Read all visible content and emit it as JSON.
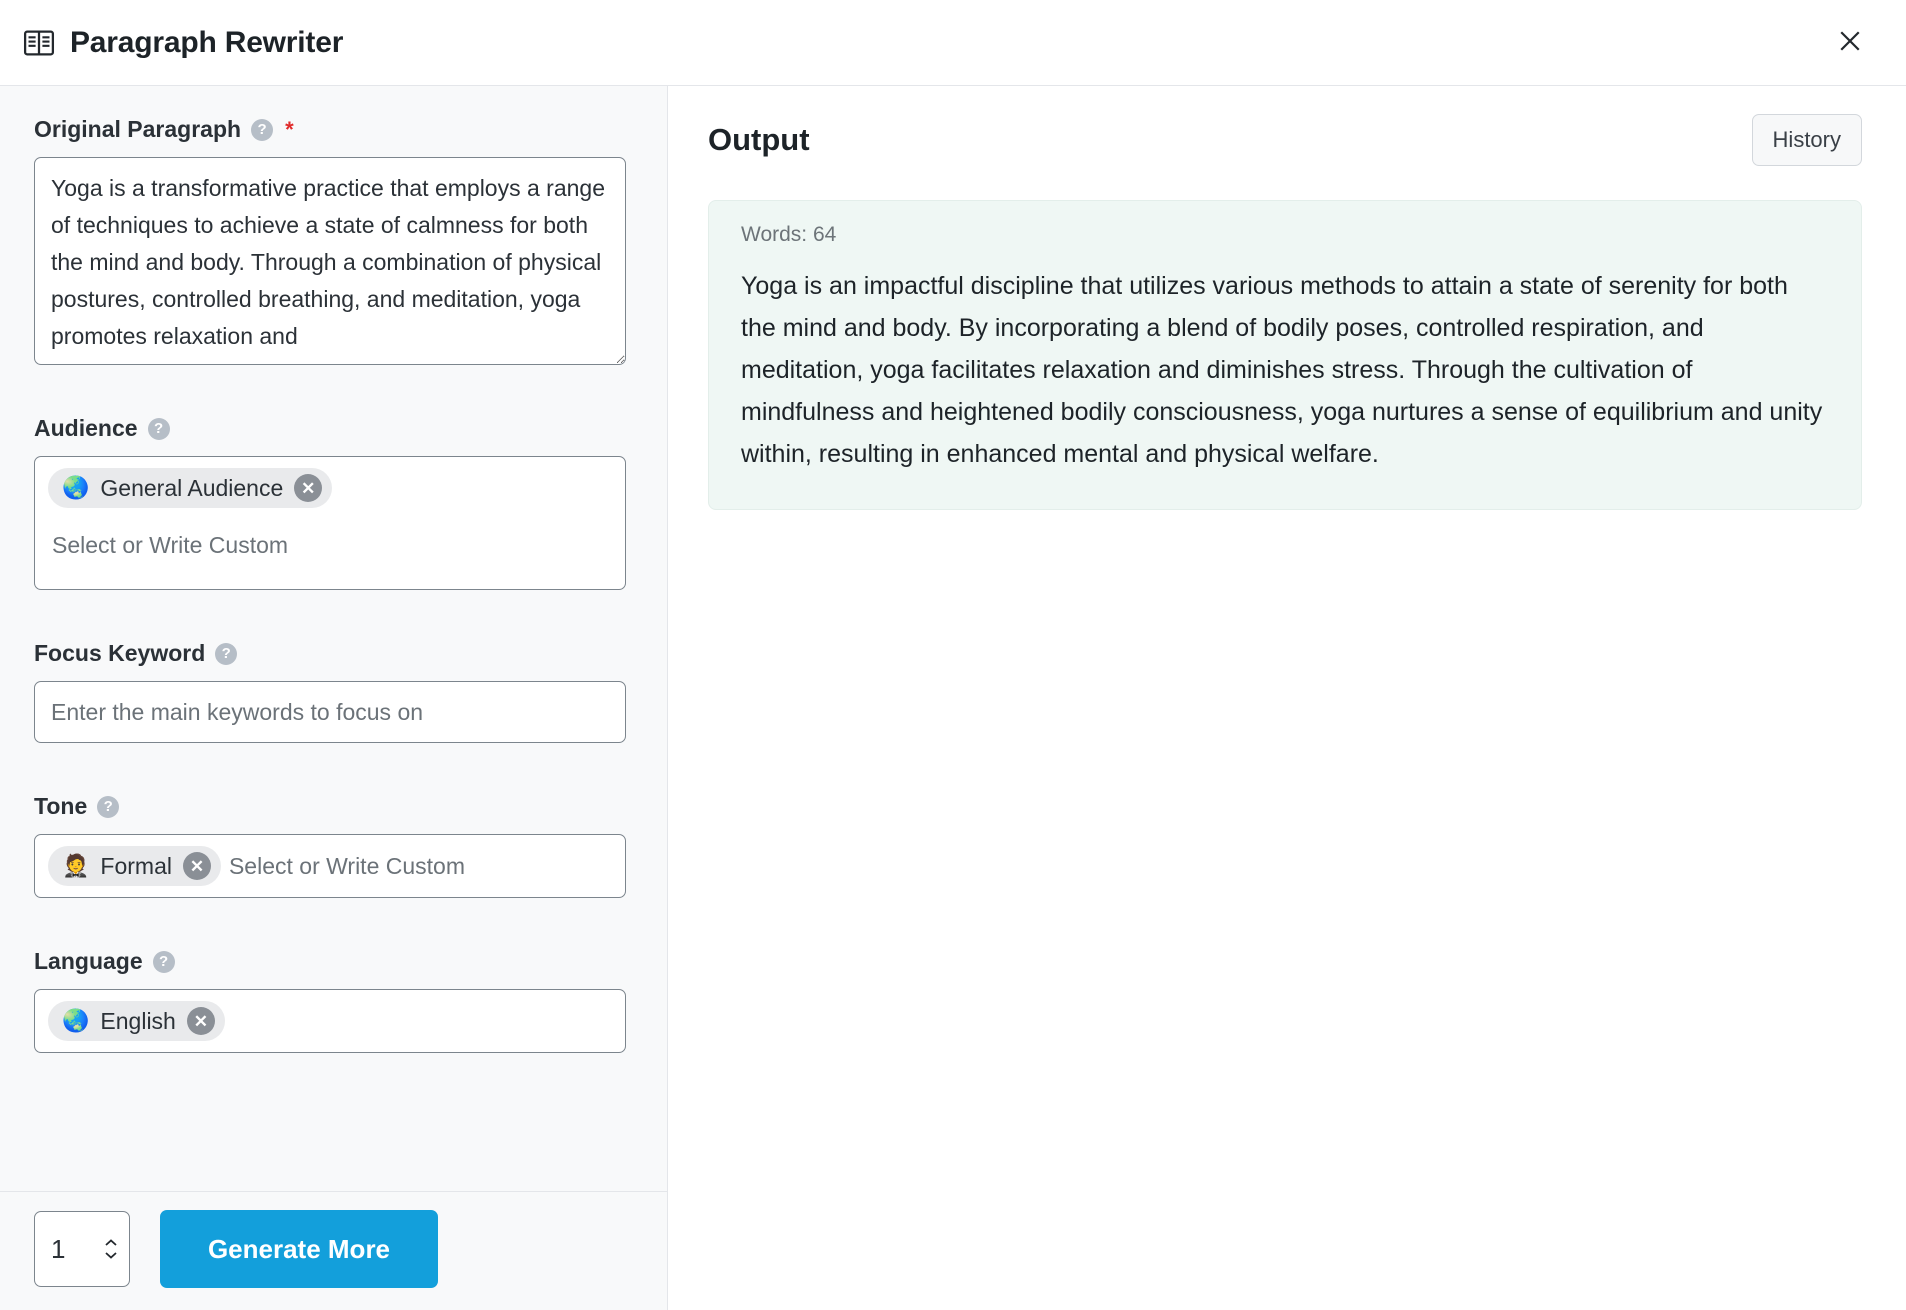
{
  "header": {
    "icon": "open-book-icon",
    "title": "Paragraph Rewriter",
    "close_label": "×"
  },
  "left_panel": {
    "original_paragraph": {
      "label": "Original Paragraph",
      "help": "?",
      "required_mark": "*",
      "value": "Yoga is a transformative practice that employs a range of techniques to achieve a state of calmness for both the mind and body. Through a combination of physical postures, controlled breathing, and meditation, yoga promotes relaxation and"
    },
    "audience": {
      "label": "Audience",
      "help": "?",
      "chip": {
        "emoji": "🌏",
        "label": "General Audience",
        "remove": "✕"
      },
      "placeholder": "Select or Write Custom"
    },
    "focus_keyword": {
      "label": "Focus Keyword",
      "help": "?",
      "value": "",
      "placeholder": "Enter the main keywords to focus on"
    },
    "tone": {
      "label": "Tone",
      "help": "?",
      "chip": {
        "emoji": "🤵",
        "label": "Formal",
        "remove": "✕"
      },
      "placeholder": "Select or Write Custom"
    },
    "language": {
      "label": "Language",
      "help": "?",
      "chip": {
        "emoji": "🌏",
        "label": "English",
        "remove": "✕"
      }
    },
    "footer": {
      "count_value": "1",
      "generate_label": "Generate More"
    }
  },
  "right_panel": {
    "title": "Output",
    "history_label": "History",
    "result": {
      "words_label": "Words: 64",
      "text": "Yoga is an impactful discipline that utilizes various methods to attain a state of serenity for both the mind and body. By incorporating a blend of bodily poses, controlled respiration, and meditation, yoga facilitates relaxation and diminishes stress. Through the cultivation of mindfulness and heightened bodily consciousness, yoga nurtures a sense of equilibrium and unity within, resulting in enhanced mental and physical welfare."
    }
  },
  "colors": {
    "accent": "#139fdb",
    "panel_bg": "#f8f9fa",
    "output_card_bg": "#eff7f4",
    "required_star": "#e02b2b",
    "chip_bg": "#e9eaec"
  }
}
